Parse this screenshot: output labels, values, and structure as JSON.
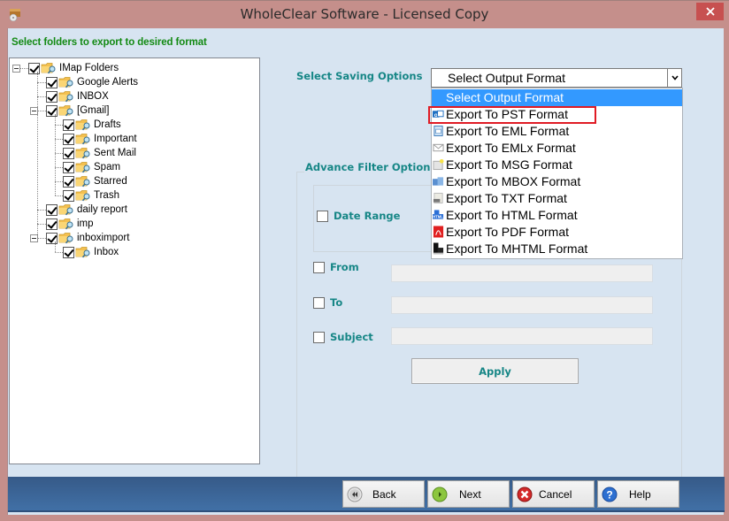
{
  "window": {
    "title": "WholeClear Software - Licensed Copy",
    "close_icon": "close-icon",
    "app_icon": "app-disc-box-icon"
  },
  "heading": "Select folders to export to desired format",
  "tree": {
    "nodes": [
      {
        "label": "IMap Folders",
        "checked": true,
        "expanded": true,
        "level": 0
      },
      {
        "label": "Google Alerts",
        "checked": true,
        "level": 1
      },
      {
        "label": "INBOX",
        "checked": true,
        "level": 1
      },
      {
        "label": "[Gmail]",
        "checked": true,
        "expanded": true,
        "level": 1
      },
      {
        "label": "Drafts",
        "checked": true,
        "level": 2
      },
      {
        "label": "Important",
        "checked": true,
        "level": 2
      },
      {
        "label": "Sent Mail",
        "checked": true,
        "level": 2
      },
      {
        "label": "Spam",
        "checked": true,
        "level": 2
      },
      {
        "label": "Starred",
        "checked": true,
        "level": 2
      },
      {
        "label": "Trash",
        "checked": true,
        "level": 2
      },
      {
        "label": "daily report",
        "checked": true,
        "level": 1
      },
      {
        "label": "imp",
        "checked": true,
        "level": 1
      },
      {
        "label": "inboximport",
        "checked": true,
        "expanded": true,
        "level": 1
      },
      {
        "label": "Inbox",
        "checked": true,
        "level": 2
      }
    ]
  },
  "saving": {
    "label": "Select Saving Options",
    "selected": "Select Output Format",
    "options": [
      {
        "label": "Select Output Format",
        "icon": "",
        "selected": true
      },
      {
        "label": "Export To PST Format",
        "icon": "outlook-icon",
        "highlighted": true
      },
      {
        "label": "Export To EML Format",
        "icon": "eml-file-icon"
      },
      {
        "label": "Export To EMLx Format",
        "icon": "envelope-icon"
      },
      {
        "label": "Export To MSG Format",
        "icon": "msg-file-icon"
      },
      {
        "label": "Export To MBOX Format",
        "icon": "mbox-icon"
      },
      {
        "label": "Export To TXT Format",
        "icon": "txt-file-icon"
      },
      {
        "label": "Export To HTML Format",
        "icon": "html-file-icon"
      },
      {
        "label": "Export To PDF Format",
        "icon": "pdf-file-icon"
      },
      {
        "label": "Export To MHTML Format",
        "icon": "mhtml-file-icon"
      }
    ]
  },
  "filter": {
    "title": "Advance Filter Option",
    "date_range": {
      "label": "Date Range",
      "checked": false
    },
    "from": {
      "label": "From",
      "checked": false,
      "value": ""
    },
    "to": {
      "label": "To",
      "checked": false,
      "value": ""
    },
    "subject": {
      "label": "Subject",
      "checked": false,
      "value": ""
    },
    "apply_label": "Apply"
  },
  "footer": {
    "back": "Back",
    "next": "Next",
    "cancel": "Cancel",
    "help": "Help"
  },
  "colors": {
    "titlebar": "#c58f8b",
    "close": "#c75050",
    "client_bg": "#d7e4f1",
    "heading_green": "#138a13",
    "label_teal": "#168686",
    "selection_blue": "#3399ff",
    "highlight_red": "#e01b24",
    "footer_blue": "#3d6a9e"
  }
}
